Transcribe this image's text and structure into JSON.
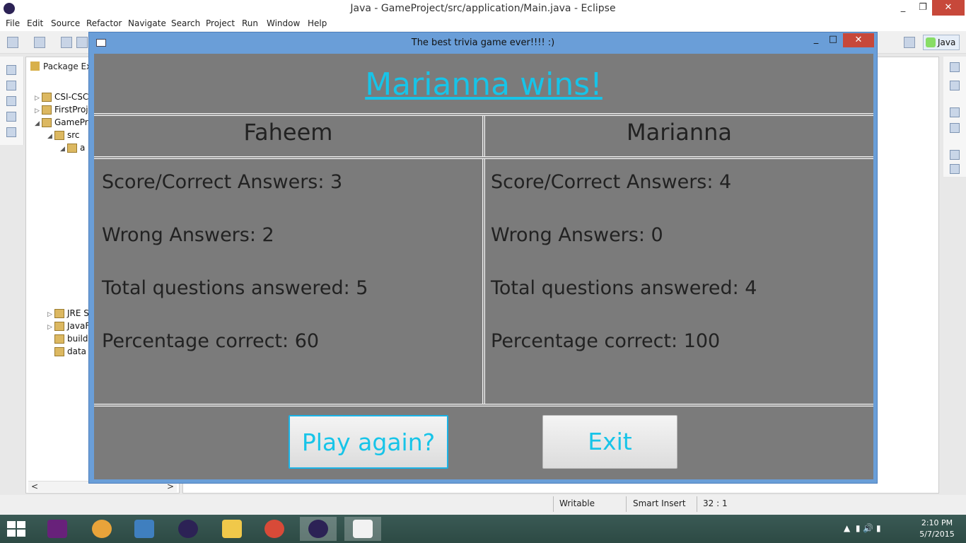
{
  "window": {
    "title": "Java - GameProject/src/application/Main.java - Eclipse",
    "minimize": "_",
    "maximize": "❐",
    "close": "✕"
  },
  "menu": [
    "File",
    "Edit",
    "Source",
    "Refactor",
    "Navigate",
    "Search",
    "Project",
    "Run",
    "Window",
    "Help"
  ],
  "perspective": {
    "label": "Java"
  },
  "package_explorer": {
    "tab_label": "Package Exp",
    "tree": [
      {
        "label": "CSI-CSC",
        "arrow": "▷"
      },
      {
        "label": "FirstProj",
        "arrow": "▷"
      },
      {
        "label": "GamePr",
        "arrow": "◢"
      },
      {
        "label": "src",
        "arrow": "◢"
      },
      {
        "label": "a",
        "arrow": "◢"
      },
      {
        "label": "JRE S",
        "arrow": "▷"
      },
      {
        "label": "JavaF",
        "arrow": "▷"
      },
      {
        "label": "build",
        "arrow": ""
      },
      {
        "label": "data",
        "arrow": ""
      }
    ],
    "scroll_left": "<",
    "scroll_right": ">"
  },
  "status_bar": {
    "writable": "Writable",
    "insert_mode": "Smart Insert",
    "position": "32 : 1"
  },
  "clock": {
    "time": "2:10 PM",
    "date": "5/7/2015"
  },
  "dialog": {
    "title": "The best trivia game ever!!!!  :)",
    "min": "_",
    "max": "□",
    "close": "✕",
    "winner_text": "Marianna wins!",
    "players": [
      {
        "name": "Faheem",
        "score": "Score/Correct Answers: 3",
        "wrong": "Wrong Answers: 2",
        "total": "Total questions answered: 5",
        "percentage": "Percentage correct: 60"
      },
      {
        "name": "Marianna",
        "score": "Score/Correct Answers: 4",
        "wrong": "Wrong Answers: 0",
        "total": "Total questions answered: 4",
        "percentage": "Percentage correct: 100"
      }
    ],
    "play_again_label": "Play again?",
    "exit_label": "Exit"
  },
  "colors": {
    "accent_text": "#17c4e8",
    "dialog_background": "#7b7b7b",
    "dialog_frame": "#6a9ed8",
    "close_button": "#c7483a"
  },
  "taskbar_apps": [
    "windows-start-icon",
    "visual-studio-icon",
    "eclipse-orange-icon",
    "intellij-icon",
    "eclipse-icon",
    "file-explorer-icon",
    "chrome-icon",
    "eclipse-icon-2",
    "java-app-icon"
  ]
}
